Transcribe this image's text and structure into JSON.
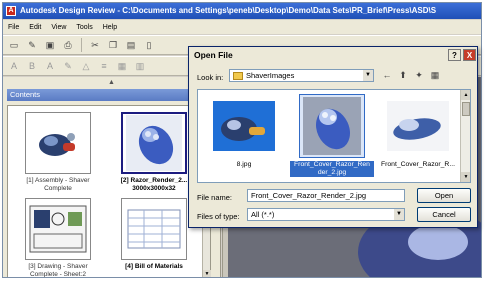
{
  "window": {
    "title": "Autodesk Design Review - C:\\Documents and Settings\\peneb\\Desktop\\Demo\\Data Sets\\PR_Brief\\Press\\ASD\\S"
  },
  "menu": {
    "items": [
      "File",
      "Edit",
      "View",
      "Tools",
      "Help"
    ]
  },
  "left_panel": {
    "header": "Contents",
    "thumbnails": [
      {
        "label": "[1] Assembly - Shaver Complete"
      },
      {
        "label": "[2] Razor_Render_2...",
        "sub": "3000x3000x32"
      },
      {
        "label": "[3] Drawing - Shaver Complete - Sheet:2"
      },
      {
        "label": "[4] Bill of Materials"
      }
    ]
  },
  "dialog": {
    "title": "Open File",
    "help_button": "?",
    "close_button": "X",
    "look_in_label": "Look in:",
    "look_in_value": "ShaverImages",
    "files": [
      {
        "name": "8.jpg",
        "selected": false
      },
      {
        "name": "Front_Cover_Razor_Render_2.jpg",
        "name_line1": "Front_Cover_Razor_Ren",
        "name_line2": "der_2.jpg",
        "selected": true
      },
      {
        "name": "Front_Cover_Razor_R...",
        "selected": false
      }
    ],
    "file_name_label": "File name:",
    "file_name_value": "Front_Cover_Razor_Render_2.jpg",
    "files_of_type_label": "Files of type:",
    "files_of_type_value": "All (*.*)",
    "open_button": "Open",
    "cancel_button": "Cancel"
  },
  "colors": {
    "title_bar": "#2a5cc8",
    "dialog_selection": "#316ac5",
    "canvas_bg": "#6b6d78"
  }
}
